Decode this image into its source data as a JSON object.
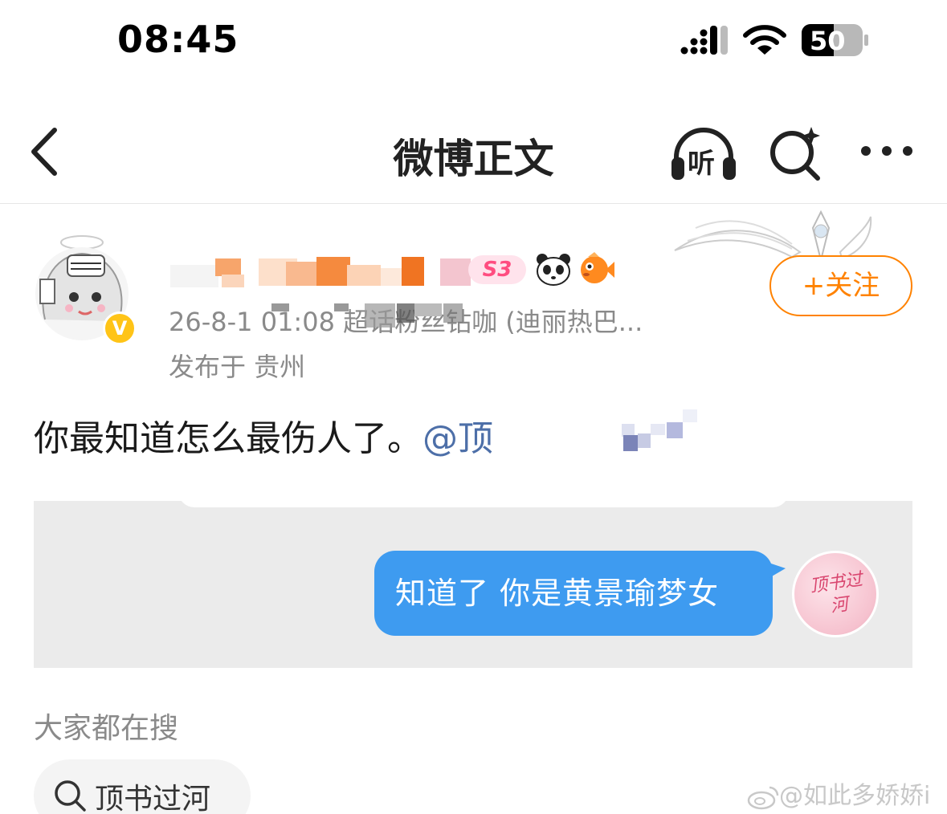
{
  "status_bar": {
    "time": "08:45",
    "battery_level": "50"
  },
  "nav": {
    "title": "微博正文",
    "listen_label": "听"
  },
  "post": {
    "follow_label": "+关注",
    "level_badge": "S3",
    "meta": "26-8-1 01:08  超话粉丝钻咖 (迪丽热巴...",
    "location": "发布于 贵州",
    "text": "你最知道怎么最伤人了。",
    "mention": "@顶"
  },
  "image": {
    "bubble_text": "知道了 你是黄景瑜梦女",
    "avatar_text": "顶书过河"
  },
  "trending": {
    "label": "大家都在搜",
    "chip": "顶书过河"
  },
  "watermark": "@如此多娇娇i",
  "colors": {
    "accent_orange": "#ff8200",
    "bubble_blue": "#3e9bf0",
    "mention_blue": "#4d6fa8",
    "meta_gray": "#8a8a8a"
  }
}
